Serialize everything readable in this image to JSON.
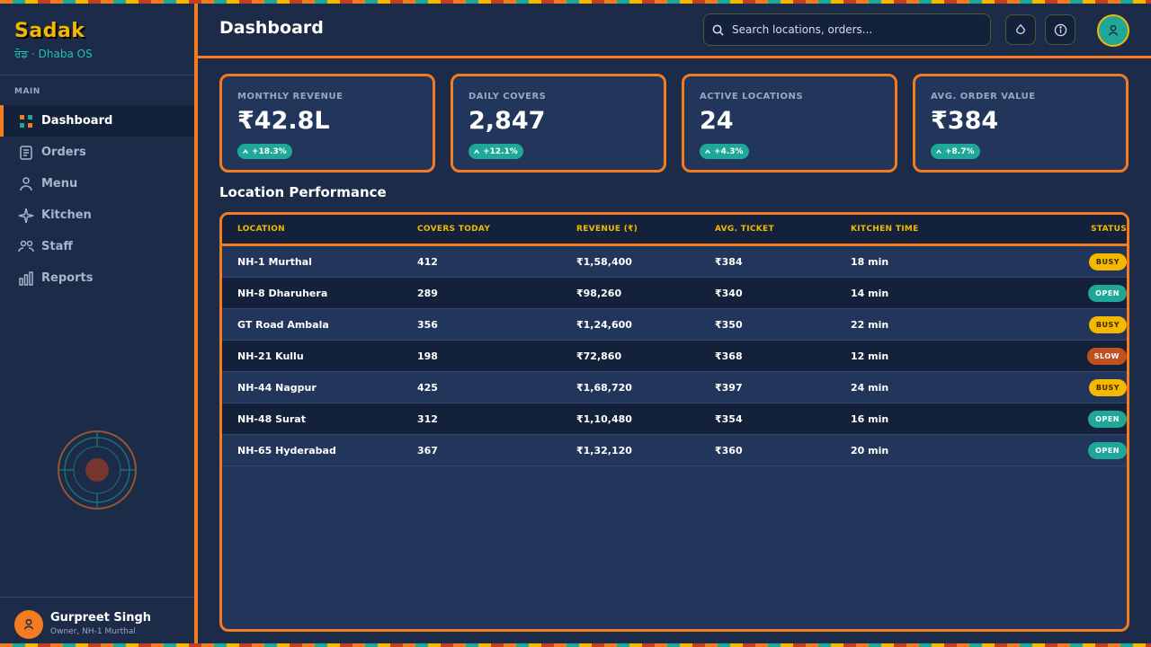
{
  "app": {
    "name": "Sadak",
    "subtitle": "ਰੋਡ · Dhaba OS"
  },
  "sidebar": {
    "section": "MAIN",
    "items": [
      {
        "label": "Dashboard",
        "icon": "grid-icon",
        "active": true
      },
      {
        "label": "Orders",
        "icon": "receipt-icon",
        "active": false
      },
      {
        "label": "Menu",
        "icon": "person-icon",
        "active": false
      },
      {
        "label": "Kitchen",
        "icon": "sparkle-icon",
        "active": false
      },
      {
        "label": "Staff",
        "icon": "users-icon",
        "active": false
      },
      {
        "label": "Reports",
        "icon": "bar-chart-icon",
        "active": false
      }
    ],
    "profile": {
      "name": "Gurpreet Singh",
      "role": "Owner, NH-1 Murthal"
    }
  },
  "header": {
    "title": "Dashboard",
    "search_placeholder": "Search locations, orders..."
  },
  "kpis": [
    {
      "label": "MONTHLY REVENUE",
      "value": "₹42.8L",
      "change": "+18.3%"
    },
    {
      "label": "DAILY COVERS",
      "value": "2,847",
      "change": "+12.1%"
    },
    {
      "label": "ACTIVE LOCATIONS",
      "value": "24",
      "change": "+4.3%"
    },
    {
      "label": "AVG. ORDER VALUE",
      "value": "₹384",
      "change": "+8.7%"
    }
  ],
  "performance": {
    "title": "Location Performance",
    "columns": [
      "LOCATION",
      "COVERS TODAY",
      "REVENUE (₹)",
      "AVG. TICKET",
      "KITCHEN TIME",
      "STATUS"
    ],
    "rows": [
      {
        "location": "NH-1 Murthal",
        "covers": "412",
        "revenue": "₹1,58,400",
        "ticket": "₹384",
        "time": "18 min",
        "status": "BUSY"
      },
      {
        "location": "NH-8 Dharuhera",
        "covers": "289",
        "revenue": "₹98,260",
        "ticket": "₹340",
        "time": "14 min",
        "status": "OPEN"
      },
      {
        "location": "GT Road Ambala",
        "covers": "356",
        "revenue": "₹1,24,600",
        "ticket": "₹350",
        "time": "22 min",
        "status": "BUSY"
      },
      {
        "location": "NH-21 Kullu",
        "covers": "198",
        "revenue": "₹72,860",
        "ticket": "₹368",
        "time": "12 min",
        "status": "SLOW"
      },
      {
        "location": "NH-44 Nagpur",
        "covers": "425",
        "revenue": "₹1,68,720",
        "ticket": "₹397",
        "time": "24 min",
        "status": "BUSY"
      },
      {
        "location": "NH-48 Surat",
        "covers": "312",
        "revenue": "₹1,10,480",
        "ticket": "₹354",
        "time": "16 min",
        "status": "OPEN"
      },
      {
        "location": "NH-65 Hyderabad",
        "covers": "367",
        "revenue": "₹1,32,120",
        "ticket": "₹360",
        "time": "20 min",
        "status": "OPEN"
      }
    ]
  },
  "colors": {
    "accent": "#f47b20",
    "gold": "#f5b800",
    "teal": "#1fa89a",
    "slow": "#c2501e",
    "background": "#1c2b47"
  }
}
